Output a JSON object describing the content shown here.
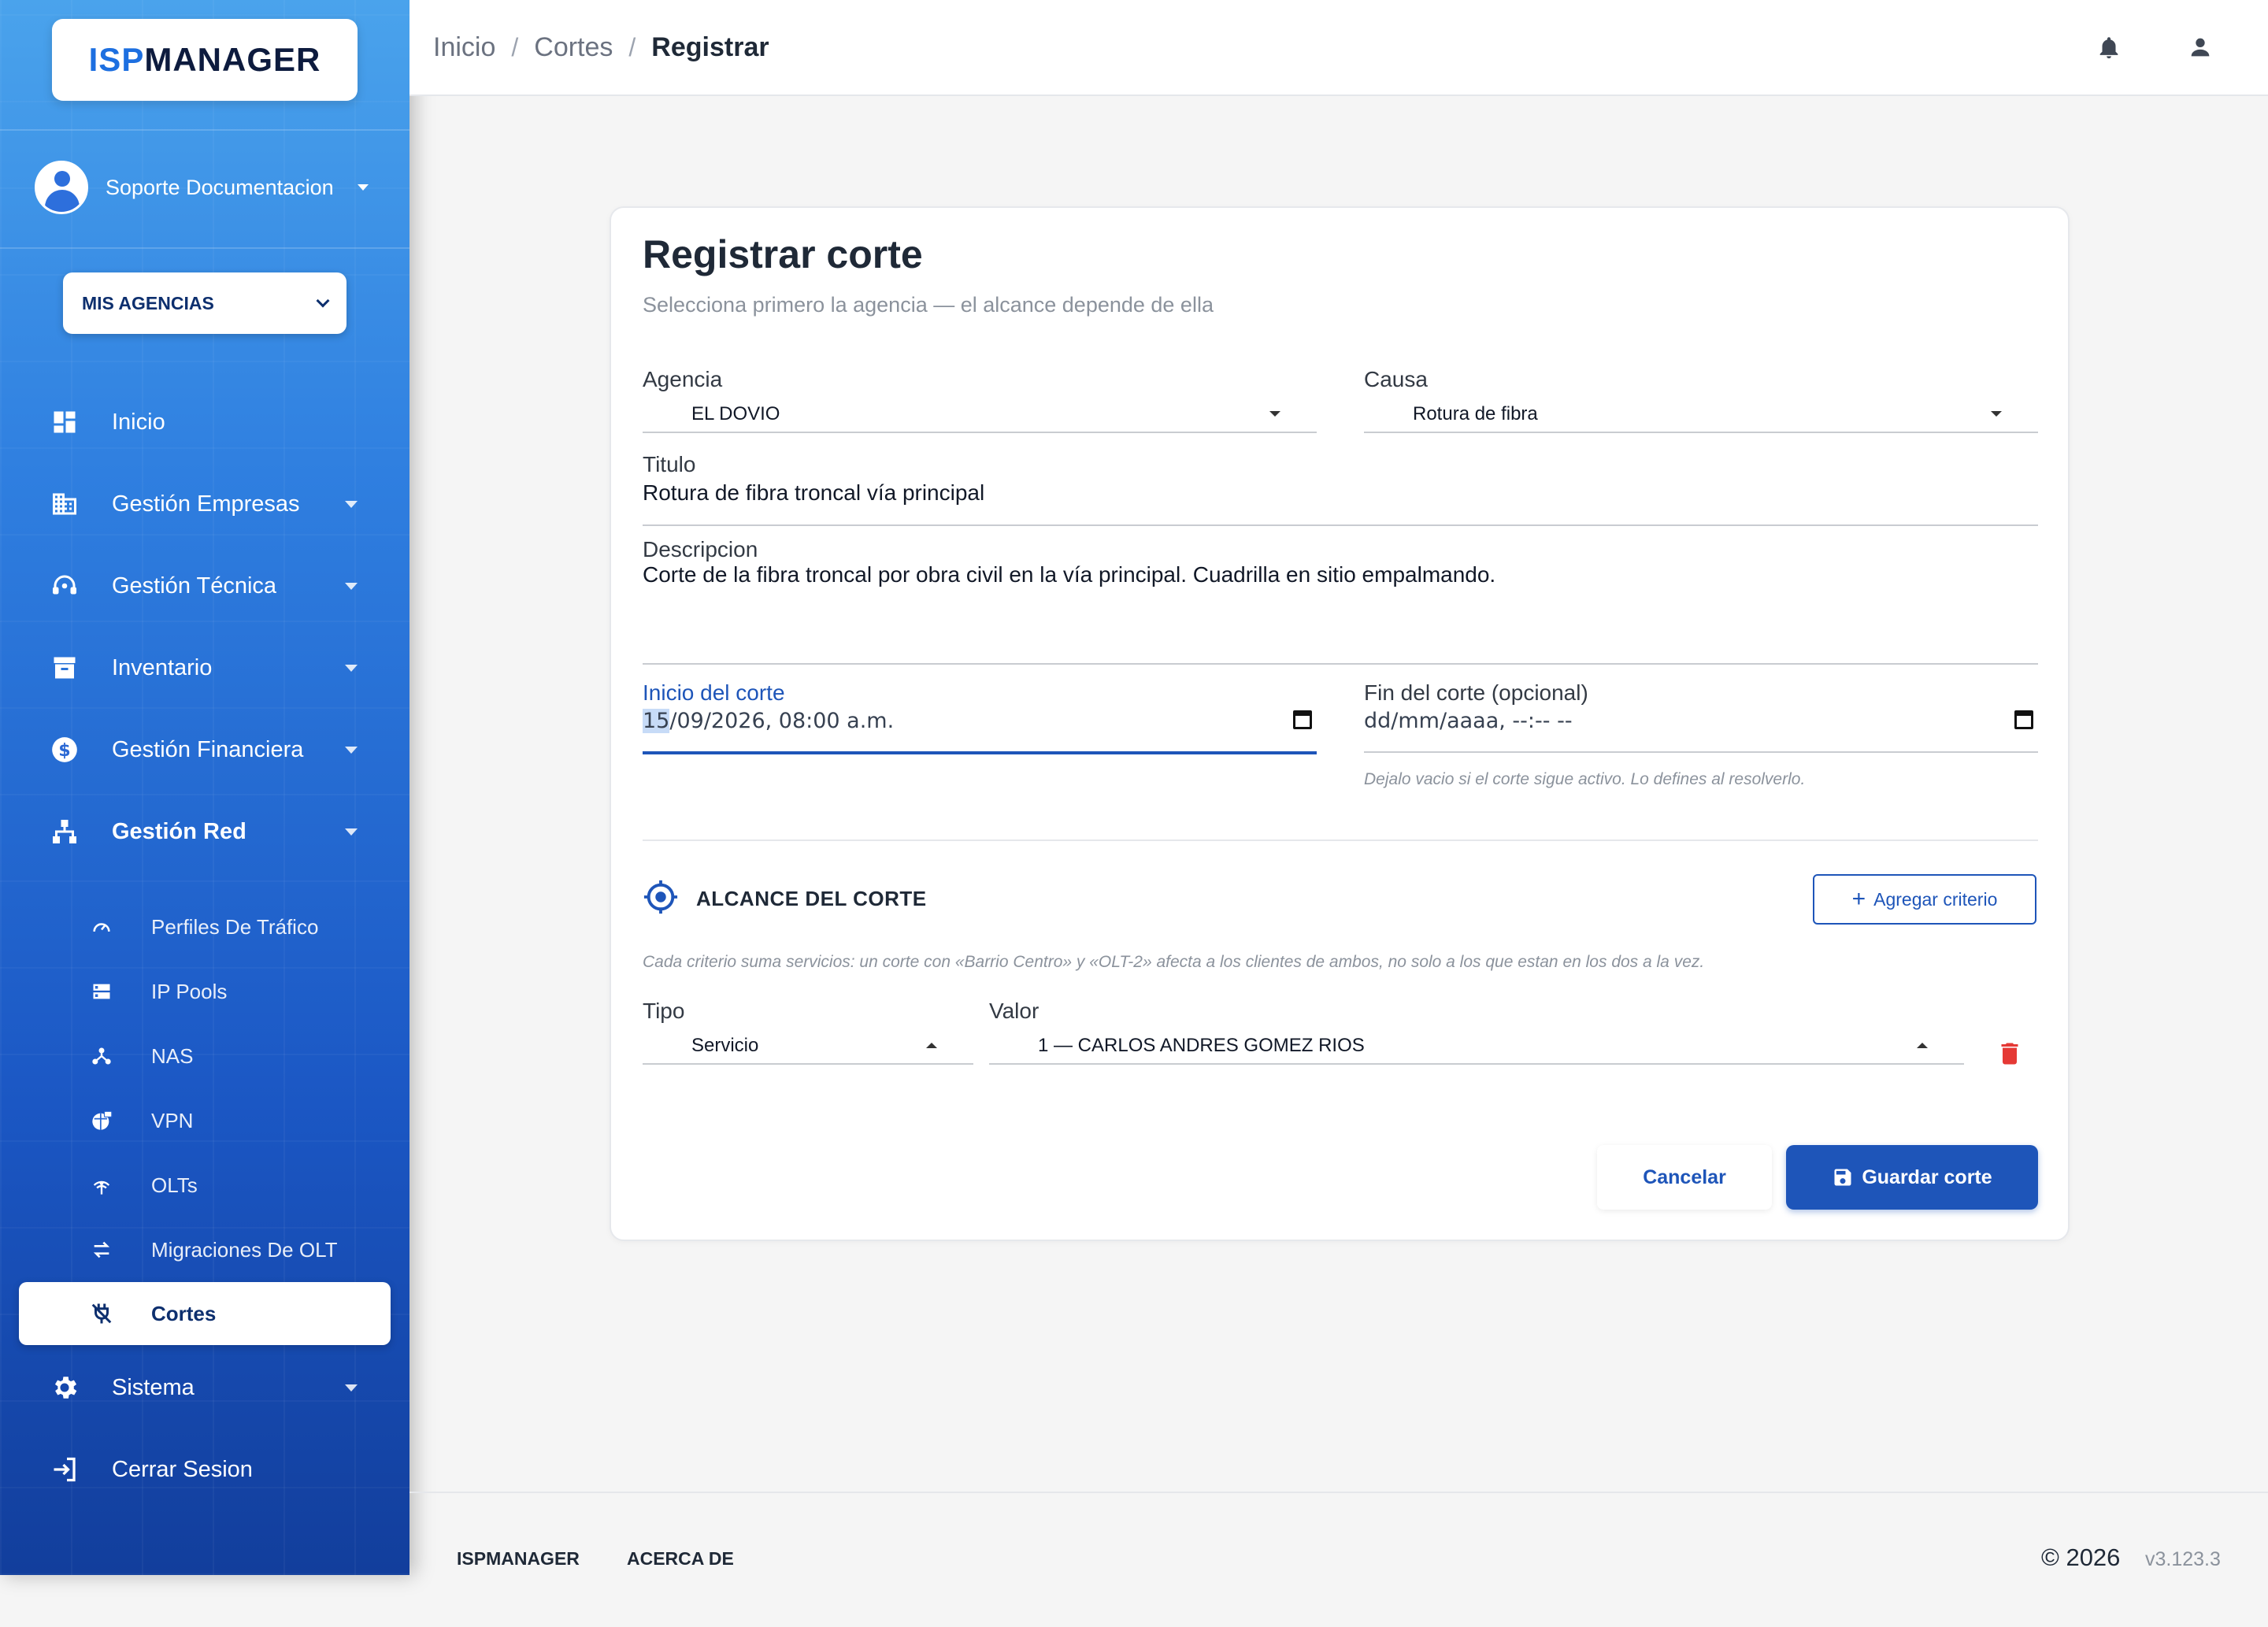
{
  "app": {
    "logo_isp": "ISP",
    "logo_manager": "MANAGER"
  },
  "user": {
    "name": "Soporte Documentacion"
  },
  "agency_button": {
    "label": "MIS AGENCIAS"
  },
  "nav": {
    "inicio": "Inicio",
    "gestion_empresas": "Gestión Empresas",
    "gestion_tecnica": "Gestión Técnica",
    "inventario": "Inventario",
    "gestion_financiera": "Gestión Financiera",
    "gestion_red": "Gestión Red",
    "sub": {
      "perfiles": "Perfiles De Tráfico",
      "ip_pools": "IP Pools",
      "nas": "NAS",
      "vpn": "VPN",
      "olts": "OLTs",
      "migraciones": "Migraciones De OLT",
      "cortes": "Cortes"
    },
    "sistema": "Sistema",
    "cerrar_sesion": "Cerrar Sesion"
  },
  "breadcrumb": {
    "home": "Inicio",
    "section": "Cortes",
    "current": "Registrar",
    "sep": "/"
  },
  "form": {
    "title": "Registrar corte",
    "subtitle": "Selecciona primero la agencia — el alcance depende de ella",
    "agencia": {
      "label": "Agencia",
      "value": "EL DOVIO"
    },
    "causa": {
      "label": "Causa",
      "value": "Rotura de fibra"
    },
    "titulo": {
      "label": "Titulo",
      "value": "Rotura de fibra troncal vía principal"
    },
    "descripcion": {
      "label": "Descripcion",
      "value": "Corte de la fibra troncal por obra civil en la vía principal. Cuadrilla en sitio empalmando."
    },
    "inicio": {
      "label": "Inicio del corte",
      "value_day": "15",
      "value_rest": "/09/2026, 08:00 a.m."
    },
    "fin": {
      "label": "Fin del corte (opcional)",
      "placeholder": "dd/mm/aaaa, --:-- --",
      "hint": "Dejalo vacio si el corte sigue activo. Lo defines al resolverlo."
    },
    "scope": {
      "title": "ALCANCE DEL CORTE",
      "add_button": "Agregar criterio",
      "hint": "Cada criterio suma servicios: un corte con «Barrio Centro» y «OLT-2» afecta a los clientes de ambos, no solo a los que estan en los dos a la vez.",
      "tipo_label": "Tipo",
      "tipo_value": "Servicio",
      "valor_label": "Valor",
      "valor_value": "1 — CARLOS ANDRES GOMEZ RIOS"
    },
    "cancel": "Cancelar",
    "save": "Guardar corte"
  },
  "footer": {
    "brand": "ISPMANAGER",
    "about": "ACERCA DE",
    "copyright": "© 2026",
    "version": "v3.123.3"
  },
  "colors": {
    "primary": "#1e55b9",
    "sidebar_top": "#4aa3ec",
    "sidebar_bottom": "#123e9c",
    "danger": "#e53935"
  }
}
